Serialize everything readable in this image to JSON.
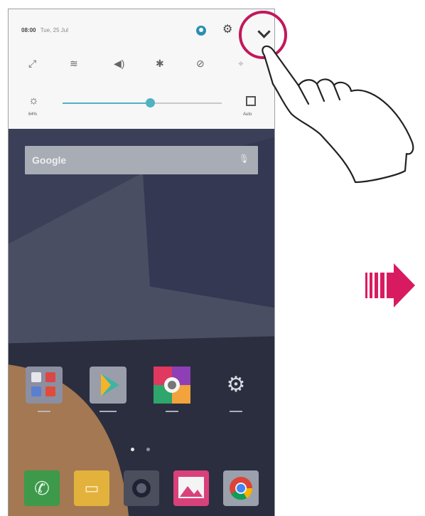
{
  "status_bar": {
    "time": "08:00",
    "date": "Tue, 25 Jul"
  },
  "quick_settings": {
    "icons": [
      "rotate-icon",
      "wifi-icon",
      "sound-icon",
      "bluetooth-icon",
      "do-not-disturb-icon",
      "location-icon"
    ],
    "brightness": {
      "percent_label": "64%",
      "level": 0.55
    },
    "auto_label": "Auto"
  },
  "search": {
    "label": "Google"
  },
  "apps": {
    "row": [
      {
        "icon": "folder-icon",
        "label": ""
      },
      {
        "icon": "play-store-icon",
        "label": ""
      },
      {
        "icon": "camera-icon",
        "label": ""
      },
      {
        "icon": "settings-icon",
        "label": ""
      }
    ],
    "dock": [
      "phone-icon",
      "messaging-icon",
      "camera-icon",
      "gallery-icon",
      "chrome-icon"
    ]
  },
  "colors": {
    "highlight_circle": "#c2185b",
    "arrow": "#d81b60",
    "brightness_accent": "#4fb3c2"
  }
}
